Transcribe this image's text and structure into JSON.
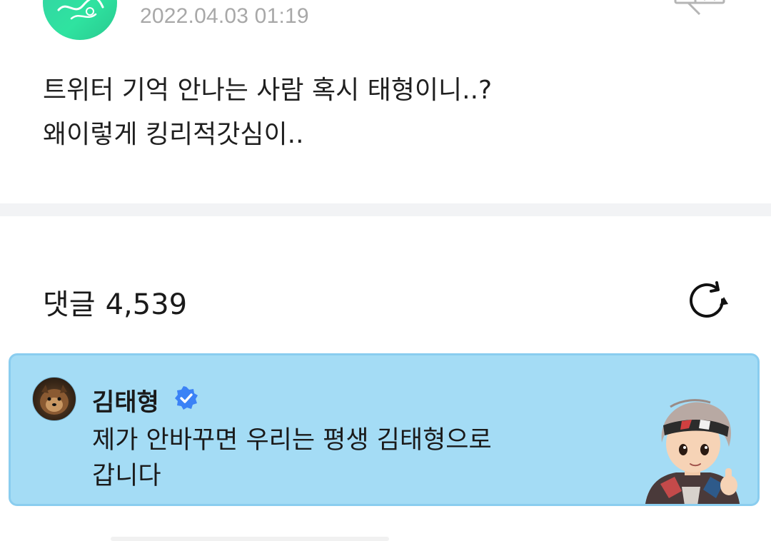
{
  "post": {
    "timestamp": "2022.04.03 01:19",
    "body_lines": [
      "트위터 기억 안나는 사람 혹시 태형이니..?",
      "왜이렇게 킹리적갓심이.."
    ]
  },
  "comments": {
    "label": "댓글",
    "count": "4,539"
  },
  "pinned_comment": {
    "author": "김태형",
    "text_lines": [
      "제가 안바꾸면 우리는 평생 김태형으로",
      "갑니다"
    ]
  },
  "icons": {
    "translate": "translate-icon",
    "refresh": "refresh-icon",
    "verified": "verified-badge-icon"
  },
  "colors": {
    "pinned_background": "#a4dcf5",
    "verified_badge": "#3b82f6",
    "avatar_green": "#2fe3a0"
  }
}
